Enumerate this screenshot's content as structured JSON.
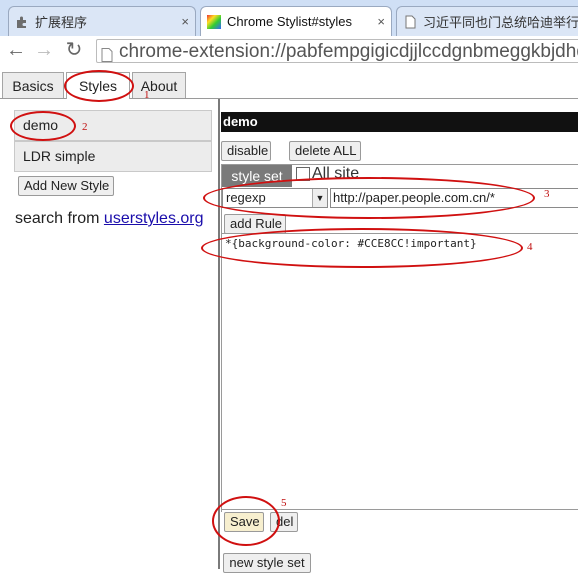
{
  "browser": {
    "tabs": [
      {
        "title": "扩展程序",
        "close": "×"
      },
      {
        "title": "Chrome Stylist#styles",
        "close": "×"
      },
      {
        "title": "习近平同也门总统哈迪举行",
        "close": "×"
      }
    ],
    "url": "chrome-extension://pabfempgigicdjjlccdgnbmeggkbjdhd/op"
  },
  "page_tabs": [
    "Basics",
    "Styles",
    "About"
  ],
  "styles_list": [
    "demo",
    "LDR simple"
  ],
  "add_new_style_label": "Add New Style",
  "search": {
    "prefix": "search from ",
    "link": "userstyles.org"
  },
  "editor": {
    "name": "demo",
    "disable_label": "disable",
    "delete_all_label": "delete ALL",
    "style_set_label": "style set",
    "all_site_label": "All site",
    "match_type": "regexp",
    "match_url": "http://paper.people.com.cn/*",
    "add_rule_label": "add Rule",
    "css": "*{background-color: #CCE8CC!important}",
    "save_label": "Save",
    "del_label": "del",
    "new_style_set_label": "new style set"
  },
  "annotations": [
    "1",
    "2",
    "3",
    "4",
    "5"
  ],
  "colors": {
    "annotation": "#d01010",
    "name_bar": "#111111",
    "style_set_tab": "#7a7a7a",
    "link": "#1a0dab"
  }
}
